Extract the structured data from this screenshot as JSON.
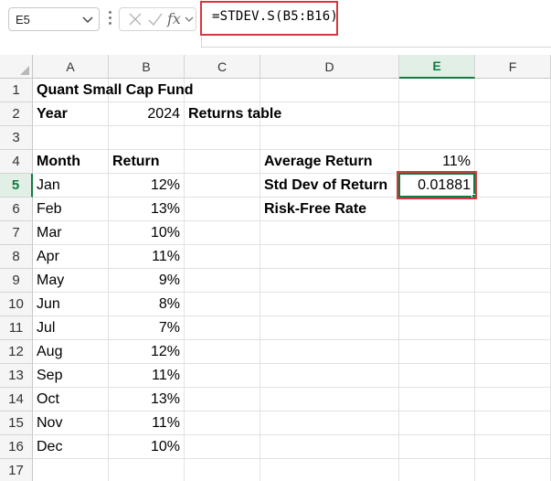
{
  "name_box": {
    "value": "E5"
  },
  "formula_bar": {
    "formula": "=STDEV.S(B5:B16)"
  },
  "columns": [
    "A",
    "B",
    "C",
    "D",
    "E",
    "F"
  ],
  "rows": [
    "1",
    "2",
    "3",
    "4",
    "5",
    "6",
    "7",
    "8",
    "9",
    "10",
    "11",
    "12",
    "13",
    "14",
    "15",
    "16",
    "17"
  ],
  "cells": {
    "A1": "Quant Small Cap Fund",
    "A2": "Year",
    "B2": "2024",
    "C2": "Returns table",
    "A4": "Month",
    "B4": "Return",
    "D4": "Average Return",
    "E4": "11%",
    "D5": "Std Dev of Return",
    "E5": "0.01881",
    "D6": "Risk-Free Rate",
    "A5": "Jan",
    "B5": "12%",
    "A6": "Feb",
    "B6": "13%",
    "A7": "Mar",
    "B7": "10%",
    "A8": "Apr",
    "B8": "11%",
    "A9": "May",
    "B9": "9%",
    "A10": "Jun",
    "B10": "8%",
    "A11": "Jul",
    "B11": "7%",
    "A12": "Aug",
    "B12": "12%",
    "A13": "Sep",
    "B13": "11%",
    "A14": "Oct",
    "B14": "13%",
    "A15": "Nov",
    "B15": "11%",
    "A16": "Dec",
    "B16": "10%"
  },
  "active_cell": "E5",
  "colors": {
    "selection": "#107c41",
    "highlight": "#d9363e"
  }
}
